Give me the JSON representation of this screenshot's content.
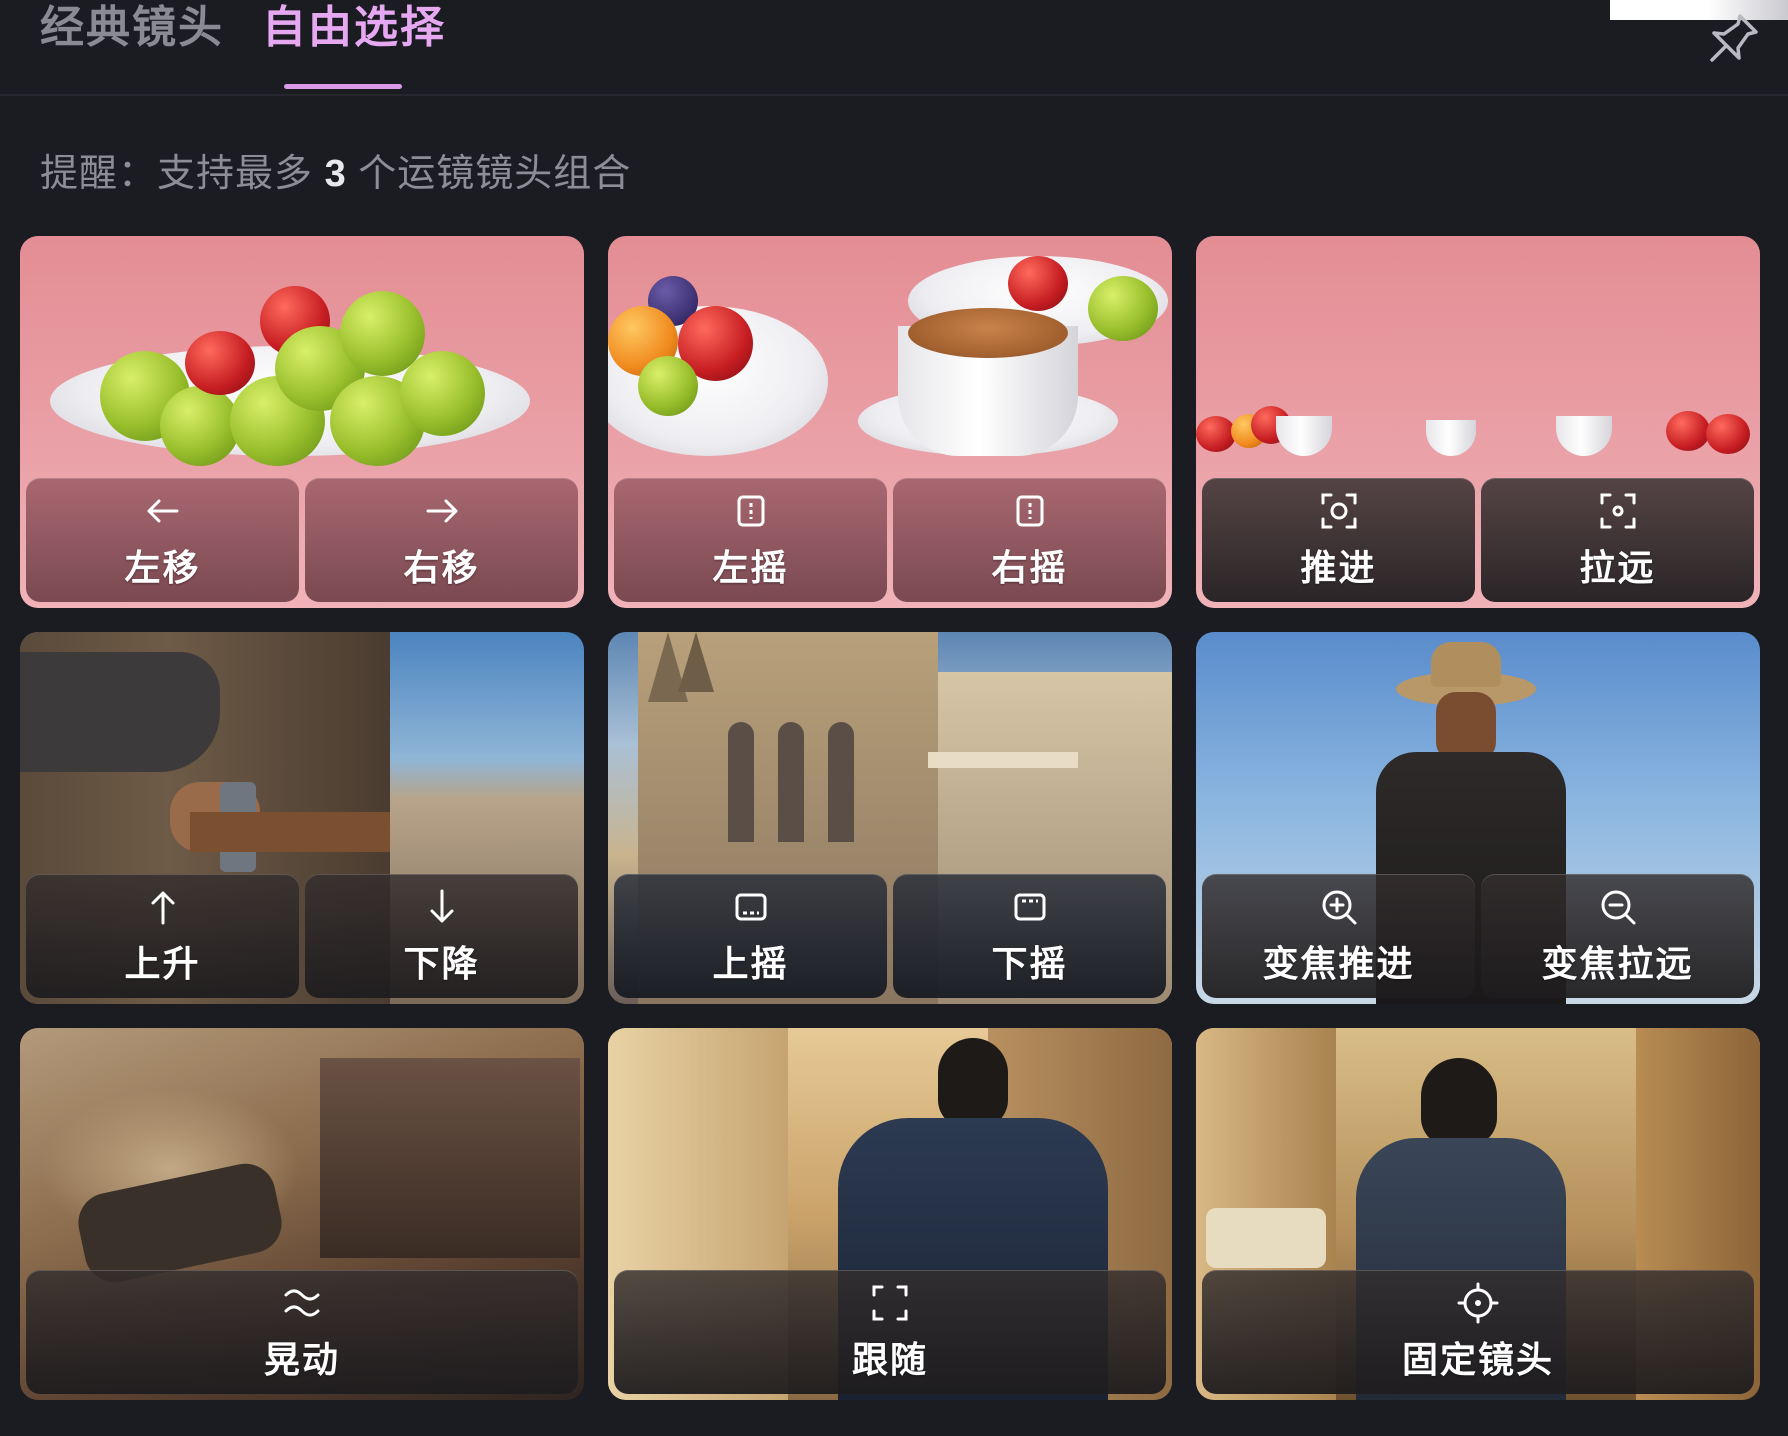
{
  "tabs": {
    "classic": "经典镜头",
    "free": "自由选择"
  },
  "hint": {
    "prefix": "提醒：支持最多",
    "count": "3",
    "suffix": "个运镜镜头组合"
  },
  "cards": [
    {
      "buttons": [
        {
          "label": "左移",
          "icon": "arrow-left-icon"
        },
        {
          "label": "右移",
          "icon": "arrow-right-icon"
        }
      ]
    },
    {
      "buttons": [
        {
          "label": "左摇",
          "icon": "pan-left-icon"
        },
        {
          "label": "右摇",
          "icon": "pan-right-icon"
        }
      ]
    },
    {
      "buttons": [
        {
          "label": "推进",
          "icon": "push-in-icon"
        },
        {
          "label": "拉远",
          "icon": "pull-out-icon"
        }
      ]
    },
    {
      "buttons": [
        {
          "label": "上升",
          "icon": "arrow-up-icon"
        },
        {
          "label": "下降",
          "icon": "arrow-down-icon"
        }
      ]
    },
    {
      "buttons": [
        {
          "label": "上摇",
          "icon": "tilt-up-icon"
        },
        {
          "label": "下摇",
          "icon": "tilt-down-icon"
        }
      ]
    },
    {
      "buttons": [
        {
          "label": "变焦推进",
          "icon": "zoom-in-icon"
        },
        {
          "label": "变焦拉远",
          "icon": "zoom-out-icon"
        }
      ]
    },
    {
      "buttons": [
        {
          "label": "晃动",
          "icon": "shake-icon"
        }
      ]
    },
    {
      "buttons": [
        {
          "label": "跟随",
          "icon": "follow-frame-icon"
        }
      ]
    },
    {
      "buttons": [
        {
          "label": "固定镜头",
          "icon": "crosshair-icon"
        }
      ]
    }
  ],
  "colors": {
    "background": "#1b1b22",
    "active_tab": "#e6a8f0",
    "inactive_tab": "#8a8a93",
    "hint_text": "#8d8d96"
  }
}
